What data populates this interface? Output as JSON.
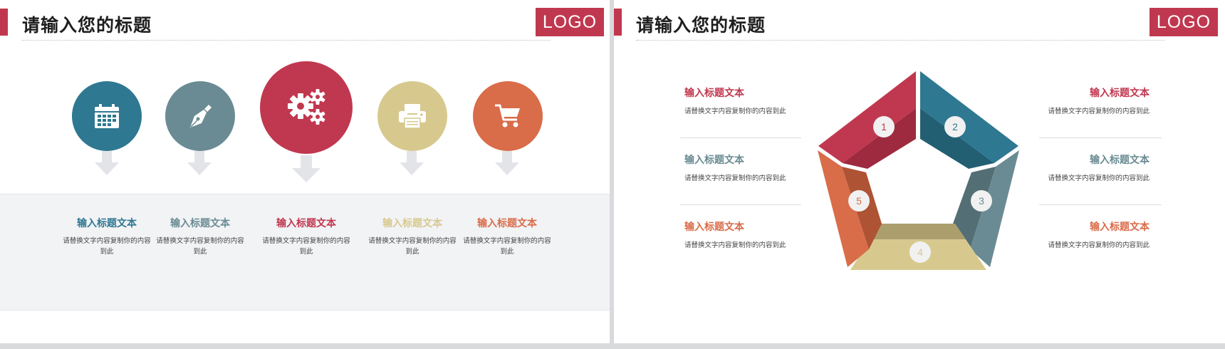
{
  "slides": [
    {
      "title": "请输入您的标题",
      "logo": "LOGO",
      "items": [
        {
          "icon": "calendar-icon",
          "color": "#2e7891",
          "title": "输入标题文本",
          "body": "请替换文字内容复制你的内容到此"
        },
        {
          "icon": "pen-nib-icon",
          "color": "#6a8b93",
          "title": "输入标题文本",
          "body": "请替换文字内容复制你的内容到此"
        },
        {
          "icon": "gears-icon",
          "color": "#c0384f",
          "title": "输入标题文本",
          "body": "请替换文字内容复制你的内容到此"
        },
        {
          "icon": "printer-icon",
          "color": "#d7c98e",
          "title": "输入标题文本",
          "body": "请替换文字内容复制你的内容到此"
        },
        {
          "icon": "shopping-cart-icon",
          "color": "#d96c49",
          "title": "输入标题文本",
          "body": "请替换文字内容复制你的内容到此"
        }
      ]
    },
    {
      "title": "请输入您的标题",
      "logo": "LOGO",
      "segments": [
        {
          "num": "1",
          "color": "#c0384f"
        },
        {
          "num": "2",
          "color": "#2e7891"
        },
        {
          "num": "3",
          "color": "#6a8b93"
        },
        {
          "num": "4",
          "color": "#d7c98e"
        },
        {
          "num": "5",
          "color": "#d96c49"
        }
      ],
      "left_items": [
        {
          "title": "输入标题文本",
          "body": "请替换文字内容复制你的内容到此",
          "color": "#c0384f"
        },
        {
          "title": "输入标题文本",
          "body": "请替换文字内容复制你的内容到此",
          "color": "#6a8b93"
        },
        {
          "title": "输入标题文本",
          "body": "请替换文字内容复制你的内容到此",
          "color": "#d96c49"
        }
      ],
      "right_items": [
        {
          "title": "输入标题文本",
          "body": "请替换文字内容复制你的内容到此",
          "color": "#c0384f"
        },
        {
          "title": "输入标题文本",
          "body": "请替换文字内容复制你的内容到此",
          "color": "#6a8b93"
        },
        {
          "title": "输入标题文本",
          "body": "请替换文字内容复制你的内容到此",
          "color": "#d96c49"
        }
      ]
    }
  ]
}
